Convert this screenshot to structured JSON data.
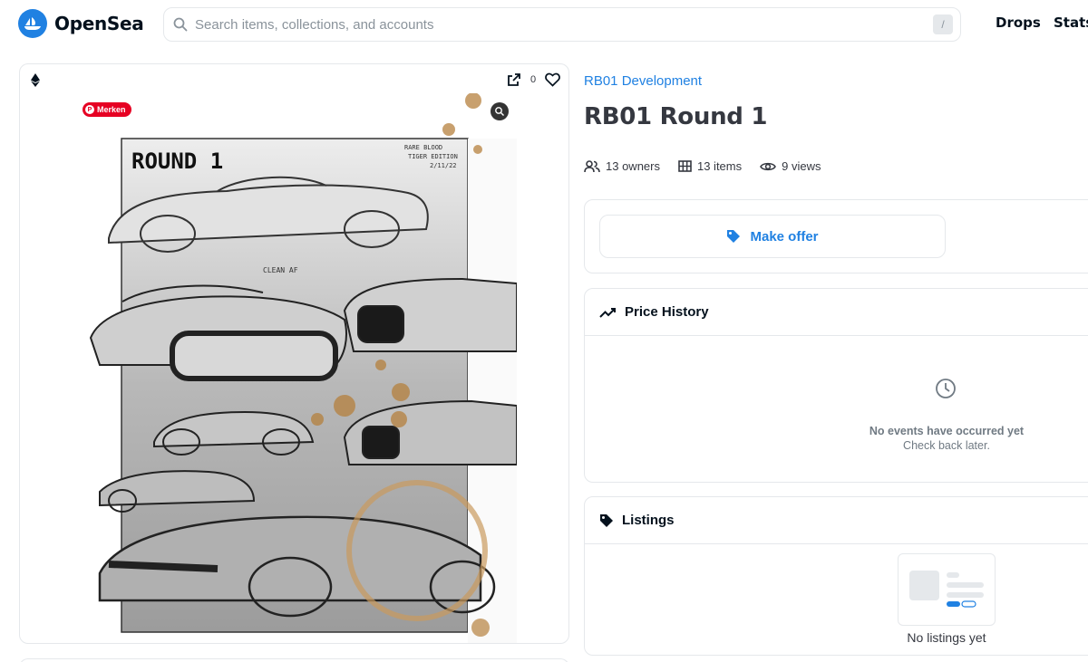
{
  "header": {
    "brand": "OpenSea",
    "search_placeholder": "Search items, collections, and accounts",
    "search_shortcut": "/",
    "nav": {
      "drops": "Drops",
      "stats": "Stats"
    }
  },
  "media": {
    "favorite_count": "0",
    "pin_label": "Merken",
    "artwork_title": "ROUND 1"
  },
  "item": {
    "collection": "RB01 Development",
    "title": "RB01 Round 1",
    "stats": {
      "owners": "13 owners",
      "items": "13 items",
      "views": "9 views"
    }
  },
  "offer": {
    "label": "Make offer"
  },
  "price_history": {
    "title": "Price History",
    "empty_title": "No events have occurred yet",
    "empty_subtitle": "Check back later."
  },
  "listings": {
    "title": "Listings",
    "empty_text": "No listings yet"
  },
  "colors": {
    "accent": "#2081e2",
    "border": "#e5e8eb",
    "text": "#353840",
    "muted": "#707a83"
  }
}
